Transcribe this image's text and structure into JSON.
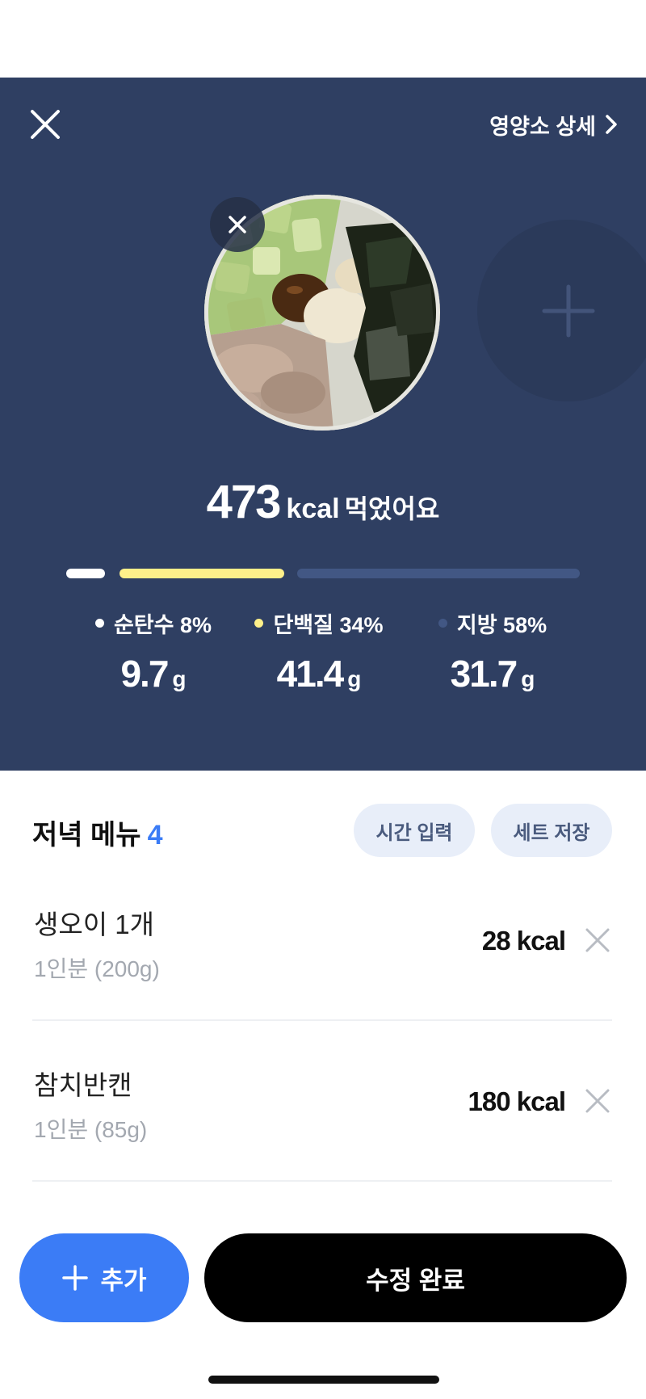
{
  "header": {
    "detail_link_label": "영양소 상세"
  },
  "summary": {
    "kcal_value": "473",
    "kcal_unit": "kcal",
    "kcal_suffix": "먹었어요"
  },
  "macros": [
    {
      "label": "순탄수 8%",
      "value": "9.7",
      "unit": "g",
      "ratio": 0.08,
      "color": "#ffffff"
    },
    {
      "label": "단백질 34%",
      "value": "41.4",
      "unit": "g",
      "ratio": 0.34,
      "color": "#fef08a"
    },
    {
      "label": "지방 58%",
      "value": "31.7",
      "unit": "g",
      "ratio": 0.58,
      "color": "#425784"
    }
  ],
  "menu": {
    "title": "저녁 메뉴",
    "count": "4",
    "time_button": "시간 입력",
    "save_set_button": "세트 저장",
    "items": [
      {
        "name": "생오이 1개",
        "portion": "1인분 (200g)",
        "kcal": "28 kcal"
      },
      {
        "name": "참치반캔",
        "portion": "1인분 (85g)",
        "kcal": "180 kcal"
      }
    ]
  },
  "footer": {
    "add_label": "추가",
    "done_label": "수정 완료"
  },
  "colors": {
    "hero_bg": "#2f3f62",
    "accent_blue": "#3b7cf6",
    "protein_yellow": "#fef08a",
    "fat_blue": "#425784"
  },
  "icons": [
    "close-icon",
    "chevron-right-icon",
    "photo-remove-icon",
    "plus-icon",
    "remove-item-icon"
  ]
}
